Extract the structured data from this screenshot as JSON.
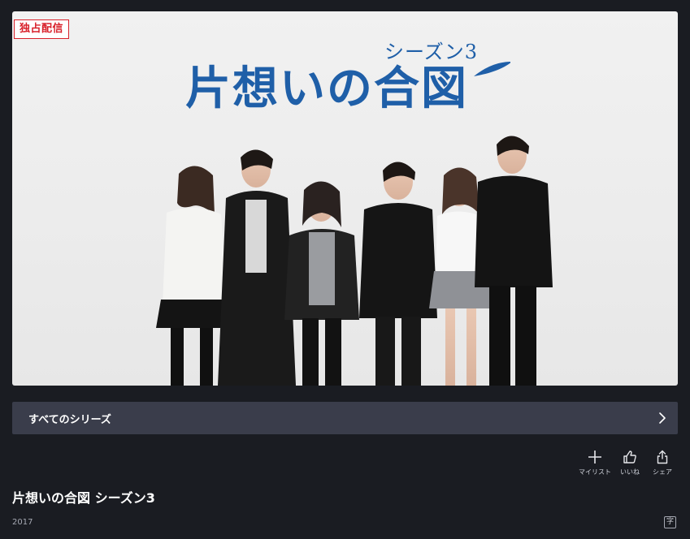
{
  "hero": {
    "badge": "独占配信",
    "title_art_season": "シーズン3",
    "title_art_main": "片想いの合図"
  },
  "series": {
    "label": "すべてのシリーズ",
    "chevron_icon": "chevron-right-icon"
  },
  "actions": [
    {
      "icon": "plus-icon",
      "label": "マイリスト"
    },
    {
      "icon": "thumbs-up-icon",
      "label": "いいね"
    },
    {
      "icon": "share-icon",
      "label": "シェア"
    }
  ],
  "details": {
    "title": "片想いの合図 シーズン3",
    "year": "2017",
    "subtitle_badge": "字"
  },
  "colors": {
    "background": "#1a1c22",
    "series_bar": "#3a3d4b",
    "badge_red": "#d8202a",
    "title_blue": "#1f5fa8"
  }
}
